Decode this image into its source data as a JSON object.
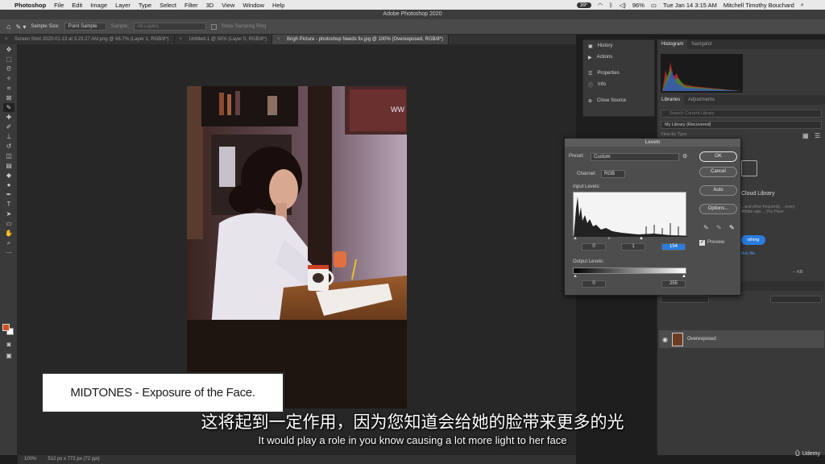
{
  "menubar": {
    "app_name": "Photoshop",
    "items": [
      "File",
      "Edit",
      "Image",
      "Layer",
      "Type",
      "Select",
      "Filter",
      "3D",
      "View",
      "Window",
      "Help"
    ],
    "status": {
      "temp": "39°",
      "battery": "96%",
      "datetime": "Tue Jan 14  3:15 AM",
      "user": "Mitchell Timothy Bouchard"
    }
  },
  "window_title": "Adobe Photoshop 2020",
  "optionsbar": {
    "sample_size_label": "Sample Size:",
    "sample_size_value": "Point Sample",
    "sample_label": "Sample:",
    "sample_value": "All Layers",
    "show_ring_label": "Show Sampling Ring"
  },
  "tabs": [
    {
      "label": "Screen Shot 2020-01-13 at 3.23.27 AM.png @ 66.7% (Layer 1, RGB/8*)",
      "active": false
    },
    {
      "label": "Untitled-1 @ 50% (Layer 0, RGB/8*)",
      "active": false
    },
    {
      "label": "Brigh Picture - photoshop Needs fix.jpg @ 100% (Overexposed, RGB/8*)",
      "active": true
    }
  ],
  "photo_watermark": "WW",
  "statusbar": {
    "zoom": "100%",
    "doc_size": "512 px x 772 px (72 ppi)"
  },
  "midpanel": {
    "items": [
      "History",
      "Actions",
      "Properties",
      "Info",
      "Close Source"
    ]
  },
  "rightpanel": {
    "tabs_top": [
      "Histogram",
      "Navigator"
    ],
    "tabs_lib": [
      "Libraries",
      "Adjustments"
    ],
    "search_placeholder": "Search Current Library",
    "library_name": "My Library (Recovered)",
    "view_by": "View by Type",
    "cc_title": "Cloud Library",
    "cc_desc": "...and other frequently ...every Adobe app. ...You Have",
    "cc_button": "othing",
    "cc_link": "this file",
    "kb_label": "-- KB",
    "layer_name": "Overexposed"
  },
  "levels": {
    "title": "Levels",
    "preset_label": "Preset:",
    "preset_value": "Custom",
    "channel_label": "Channel:",
    "channel_value": "RGB",
    "input_label": "Input Levels:",
    "input_values": [
      "0",
      "1",
      "154"
    ],
    "output_label": "Output Levels:",
    "output_values": [
      "0",
      "255"
    ],
    "buttons": {
      "ok": "OK",
      "cancel": "Cancel",
      "auto": "Auto",
      "options": "Options..."
    },
    "preview_label": "Preview",
    "preview_checked": true
  },
  "caption": "MIDTONES - Exposure of the Face.",
  "subtitles": {
    "zh": "这将起到一定作用，因为您知道会给她的脸带来更多的光",
    "en": "It would play a role in you know causing a lot more light to her face"
  },
  "brand": "Udemy",
  "colors": {
    "foreground_swatch": "#d2501e",
    "accent_blue": "#2a7ce0"
  }
}
